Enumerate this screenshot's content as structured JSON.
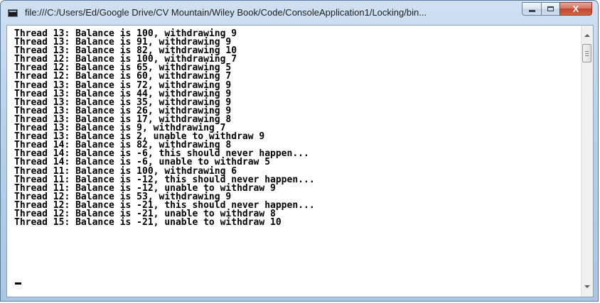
{
  "window": {
    "title": "file:///C:/Users/Ed/Google Drive/CV Mountain/Wiley Book/Code/ConsoleApplication1/Locking/bin...",
    "caption_buttons": {
      "minimize_icon": "minimize-icon",
      "maximize_icon": "maximize-icon",
      "close_label": "X"
    }
  },
  "console": {
    "lines": [
      "Thread 13: Balance is 100, withdrawing 9",
      "Thread 13: Balance is 91, withdrawing 9",
      "Thread 13: Balance is 82, withdrawing 10",
      "Thread 12: Balance is 100, withdrawing 7",
      "Thread 12: Balance is 65, withdrawing 5",
      "Thread 12: Balance is 60, withdrawing 7",
      "Thread 13: Balance is 72, withdrawing 9",
      "Thread 13: Balance is 44, withdrawing 9",
      "Thread 13: Balance is 35, withdrawing 9",
      "Thread 13: Balance is 26, withdrawing 9",
      "Thread 13: Balance is 17, withdrawing 8",
      "Thread 13: Balance is 9, withdrawing 7",
      "Thread 13: Balance is 2, unable to withdraw 9",
      "Thread 14: Balance is 82, withdrawing 8",
      "Thread 14: Balance is -6, this should never happen...",
      "Thread 14: Balance is -6, unable to withdraw 5",
      "Thread 11: Balance is 100, withdrawing 6",
      "Thread 11: Balance is -12, this should never happen...",
      "Thread 11: Balance is -12, unable to withdraw 9",
      "Thread 12: Balance is 53, withdrawing 9",
      "Thread 12: Balance is -21, this should never happen...",
      "Thread 12: Balance is -21, unable to withdraw 8",
      "Thread 15: Balance is -21, unable to withdraw 10"
    ]
  }
}
